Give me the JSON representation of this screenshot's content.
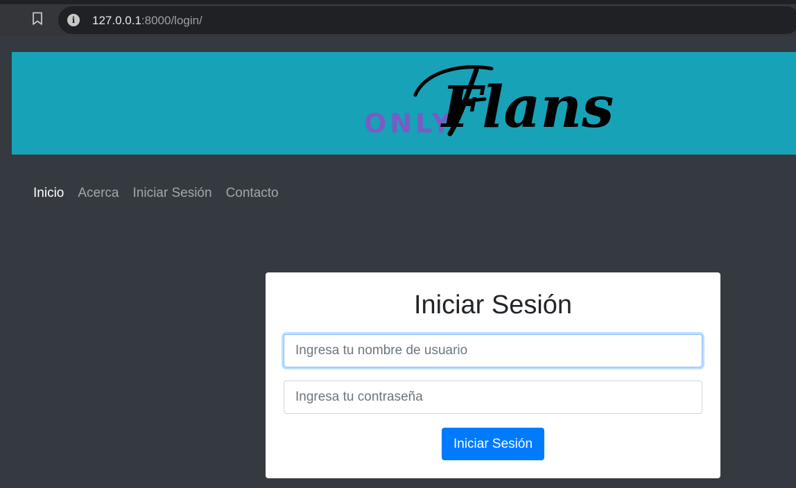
{
  "browser": {
    "url_host": "127.0.0.1",
    "url_path": ":8000/login/",
    "info_glyph": "i",
    "icons": [
      "bookmark-icon",
      "info-icon"
    ]
  },
  "logo": {
    "small_text": "ONLY",
    "script_text": "Flans",
    "small_color": "#7a5bc4",
    "script_color": "#000000"
  },
  "colors": {
    "banner": "#17a2b8",
    "page_bg": "#343a40",
    "primary": "#007bff"
  },
  "nav": {
    "items": [
      {
        "label": "Inicio",
        "active": true
      },
      {
        "label": "Acerca",
        "active": false
      },
      {
        "label": "Iniciar Sesión",
        "active": false
      },
      {
        "label": "Contacto",
        "active": false
      }
    ]
  },
  "login": {
    "title": "Iniciar Sesión",
    "username_placeholder": "Ingresa tu nombre de usuario",
    "username_value": "",
    "password_placeholder": "Ingresa tu contraseña",
    "password_value": "",
    "submit_label": "Iniciar Sesión"
  }
}
